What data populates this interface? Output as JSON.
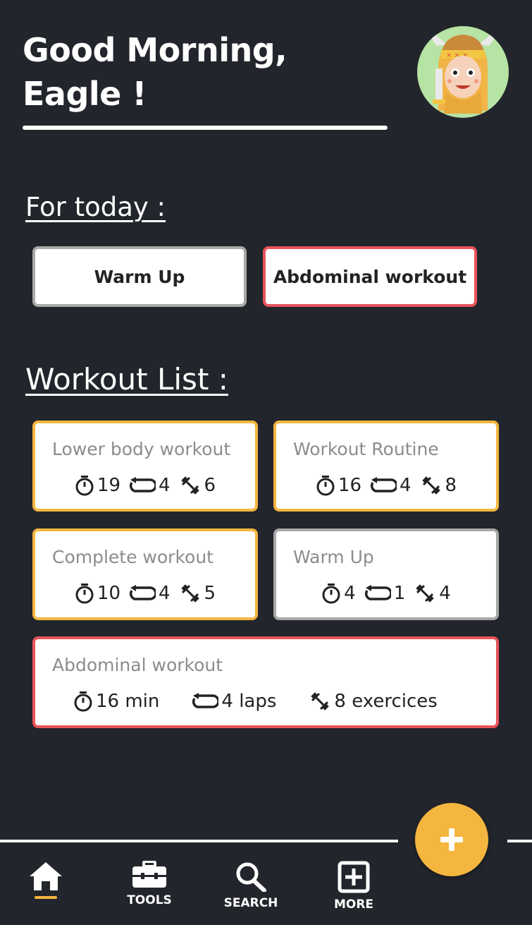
{
  "header": {
    "greeting_line1": "Good Morning,",
    "greeting_line2": "Eagle !",
    "avatar_icon": "viking-avatar-icon"
  },
  "today": {
    "title": "For today :",
    "items": [
      {
        "label": "Warm Up",
        "border": "#a8a8a8"
      },
      {
        "label": "Abdominal workout",
        "border": "#e8535a"
      }
    ]
  },
  "workouts": {
    "title": "Workout List :",
    "items": [
      {
        "title": "Lower body workout",
        "time": "19",
        "laps": "4",
        "exercises": "6",
        "border": "#f4b63f"
      },
      {
        "title": "Workout Routine",
        "time": "16",
        "laps": "4",
        "exercises": "8",
        "border": "#f4b63f"
      },
      {
        "title": "Complete workout",
        "time": "10",
        "laps": "4",
        "exercises": "5",
        "border": "#f4b63f"
      },
      {
        "title": "Warm Up",
        "time": "4",
        "laps": "1",
        "exercises": "4",
        "border": "#a8a8a8"
      },
      {
        "title": "Abdominal workout",
        "time": "16 min",
        "laps": "4 laps",
        "exercises": "8 exercices",
        "border": "#e8535a"
      }
    ]
  },
  "nav": {
    "home_icon": "home-icon",
    "tools": "TOOLS",
    "search": "SEARCH",
    "more": "MORE"
  },
  "colors": {
    "background": "#22252b",
    "accent": "#f4b63f",
    "red": "#e8535a",
    "grey": "#a8a8a8"
  }
}
